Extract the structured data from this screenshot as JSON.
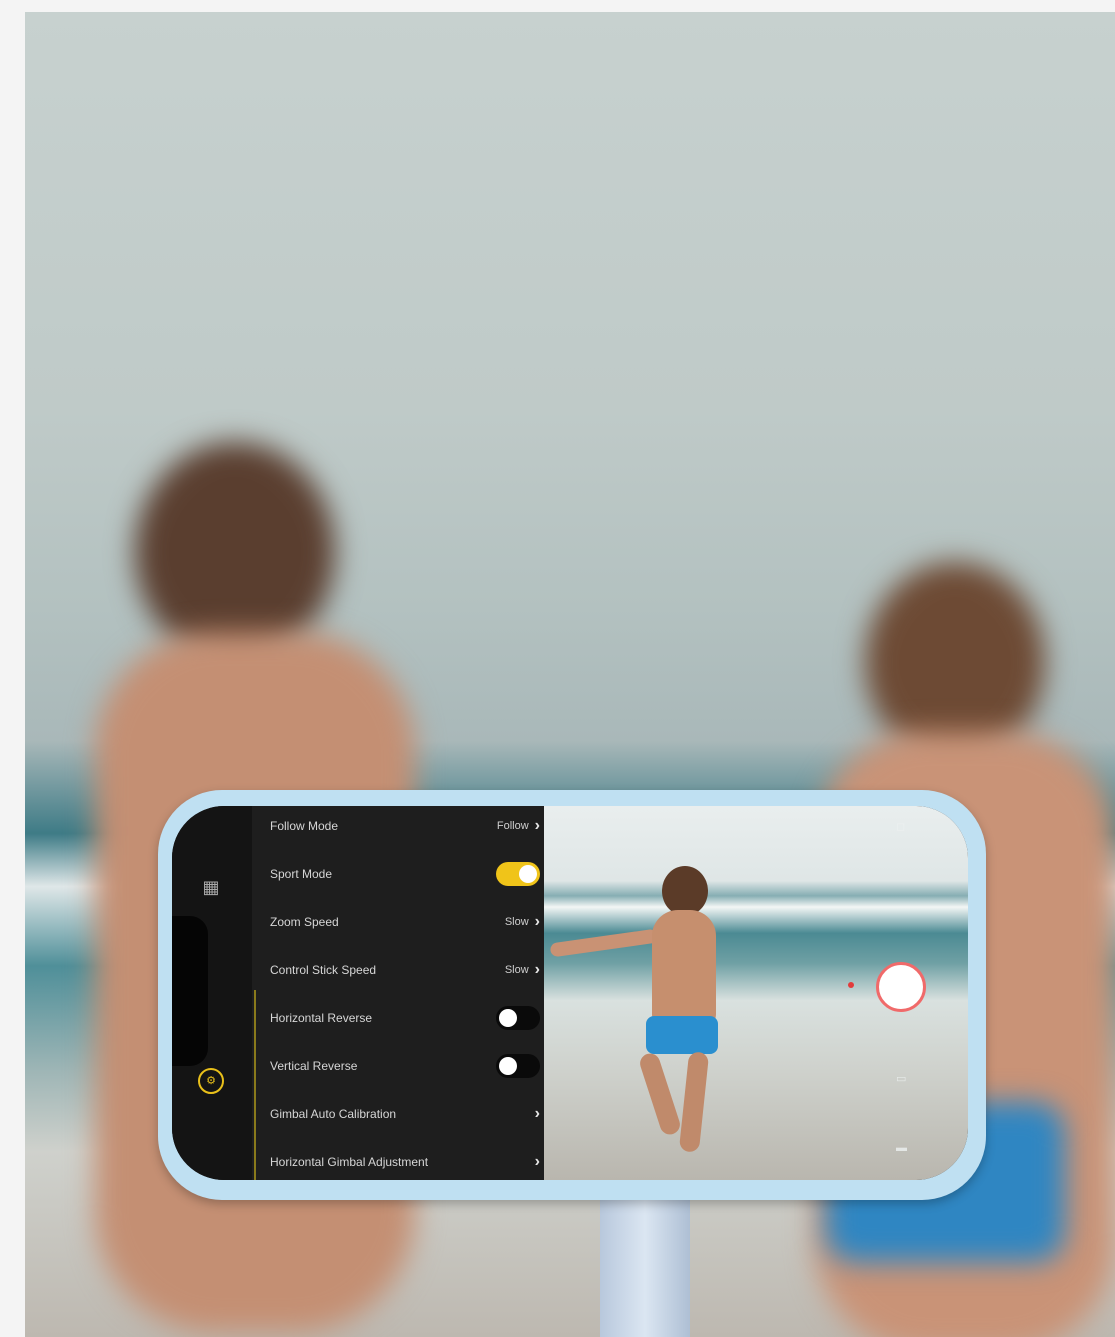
{
  "settings_menu": {
    "rows": [
      {
        "label": "Follow Mode",
        "value": "Follow",
        "control": "chevron"
      },
      {
        "label": "Sport Mode",
        "value": "",
        "control": "toggle",
        "on": true
      },
      {
        "label": "Zoom Speed",
        "value": "Slow",
        "control": "chevron"
      },
      {
        "label": "Control Stick Speed",
        "value": "Slow",
        "control": "chevron"
      },
      {
        "label": "Horizontal Reverse",
        "value": "",
        "control": "toggle",
        "on": false
      },
      {
        "label": "Vertical Reverse",
        "value": "",
        "control": "toggle",
        "on": false
      },
      {
        "label": "Gimbal Auto Calibration",
        "value": "",
        "control": "chevron"
      },
      {
        "label": "Horizontal Gimbal Adjustment",
        "value": "",
        "control": "chevron"
      }
    ]
  },
  "sidebar": {
    "icons": [
      "grid-icon",
      "gear-icon"
    ]
  },
  "camera": {
    "shutter": "record-button",
    "colors": {
      "accent": "#f0c419",
      "record": "#f06a6a"
    }
  }
}
